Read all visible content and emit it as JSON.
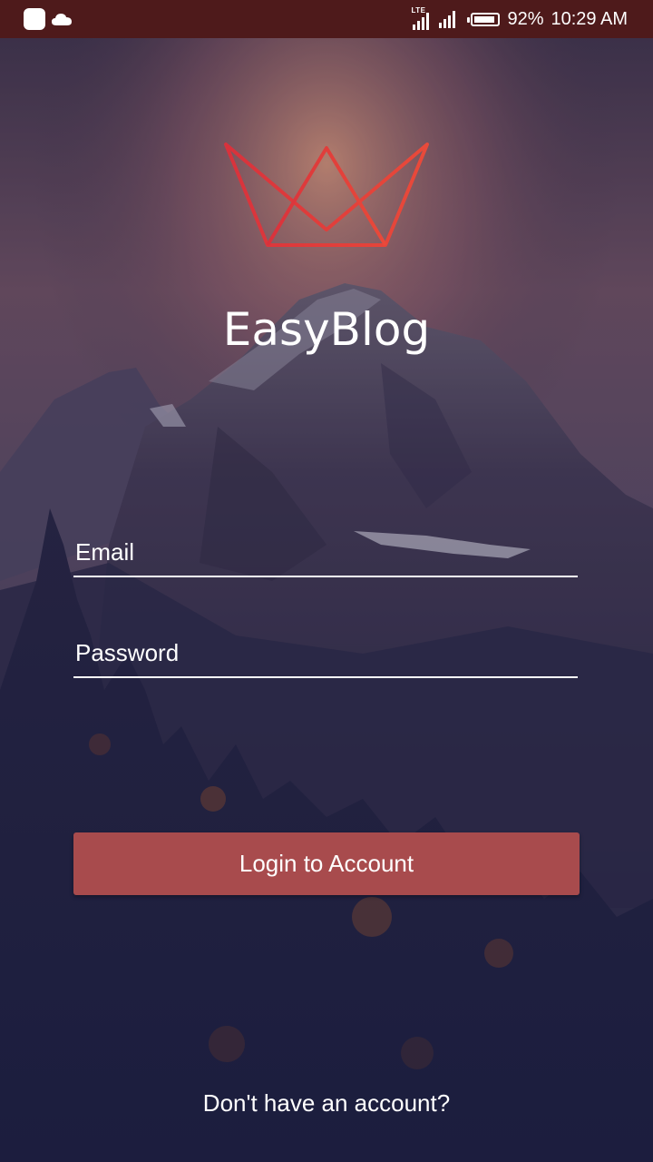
{
  "status_bar": {
    "network_label": "LTE",
    "battery_percent": "92%",
    "battery_level": 0.92,
    "time": "10:29 AM"
  },
  "app": {
    "title": "EasyBlog",
    "logo_icon": "crown-icon",
    "accent_color": "#a84b4d"
  },
  "login_form": {
    "email_placeholder": "Email",
    "email_value": "",
    "password_placeholder": "Password",
    "password_value": "",
    "login_button_label": "Login to Account"
  },
  "footer": {
    "signup_prompt": "Don't have an account?"
  }
}
